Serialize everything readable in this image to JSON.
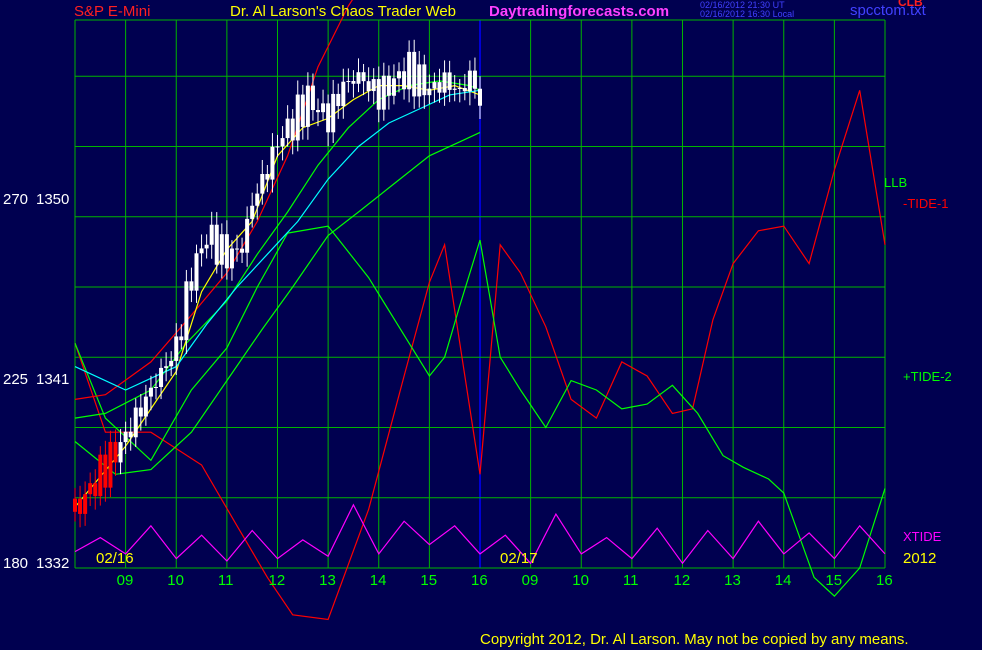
{
  "header": {
    "instrument": "S&P E-Mini",
    "app_title": "Dr. Al Larson's Chaos Trader Web",
    "site": "Daytradingforecasts.com",
    "timestamp_ut": "02/16/2012 21:30 UT",
    "timestamp_local": "02/16/2012 16:30 Local",
    "filename": "spcctom.txt",
    "clb_label": "CLB"
  },
  "footer": {
    "copyright": "Copyright 2012, Dr. Al Larson. May not be copied by any means."
  },
  "right_labels": {
    "llb": "LLB",
    "tide1": "-TIDE-1",
    "tide2": "+TIDE-2",
    "xtide": "XTIDE"
  },
  "colors": {
    "background": "#000050",
    "grid": "#00b400",
    "divider": "#0000ff",
    "price_candles": "#ffffff",
    "price_bear": "#ff0000",
    "tide1": "#ff0000",
    "tide2": "#00ff00",
    "xtide": "#ff00ff",
    "avg_fast": "#ffff00",
    "avg_slow": "#00ffff",
    "band": "#00ff00",
    "band_upper": "#ff0000",
    "title_red": "#ff2020",
    "title_yellow": "#ffff00",
    "site_magenta": "#ff40ff",
    "time_blue": "#4040ff"
  },
  "chart_data": {
    "type": "line",
    "y_labels": [
      {
        "left": "270",
        "price": "1350",
        "value": 1350
      },
      {
        "left": "225",
        "price": "1341",
        "value": 1341
      },
      {
        "left": "180",
        "price": "1332",
        "value": 1332
      }
    ],
    "ylim": [
      1332,
      1355.4
    ],
    "x_ticks": [
      "09",
      "10",
      "11",
      "12",
      "13",
      "14",
      "15",
      "16",
      "09",
      "10",
      "11",
      "12",
      "13",
      "14",
      "15",
      "16"
    ],
    "date_labels": [
      "02/16",
      "02/17",
      "2012"
    ],
    "price_series": {
      "name": "S&P E-Mini",
      "x": [
        8.0,
        8.5,
        9.0,
        9.5,
        10.0,
        10.3,
        10.6,
        11.0,
        11.3,
        11.5,
        11.8,
        12.0,
        12.3,
        12.6,
        13.0,
        13.3,
        13.6,
        14.0,
        14.3,
        14.6,
        15.0,
        15.3,
        15.6,
        15.8,
        16.0
      ],
      "close": [
        1334.4,
        1336.0,
        1337.6,
        1339.6,
        1341.4,
        1344.5,
        1346.2,
        1345.3,
        1345.7,
        1347.6,
        1349.0,
        1350.2,
        1351.0,
        1352.0,
        1351.2,
        1352.6,
        1353.0,
        1352.2,
        1352.8,
        1353.2,
        1352.4,
        1352.8,
        1352.3,
        1353.0,
        1352.0
      ]
    },
    "series": [
      {
        "name": "-TIDE-1",
        "x": [
          8.0,
          8.6,
          9.5,
          10.5,
          11.2,
          11.8,
          12.3,
          13.0,
          13.8,
          14.5,
          15.0,
          15.3,
          15.6,
          16.0,
          16.4,
          16.8,
          17.3,
          17.8,
          18.3,
          18.8,
          19.3,
          19.8,
          20.2,
          20.6,
          21.0,
          21.5,
          22.0,
          22.5,
          23.0,
          23.5,
          24.0
        ],
        "values": [
          1341.6,
          1337.8,
          1337.8,
          1336.4,
          1333.8,
          1331.6,
          1330.0,
          1329.8,
          1334.5,
          1340.2,
          1344.2,
          1345.8,
          1341.6,
          1336.0,
          1345.8,
          1344.6,
          1342.3,
          1339.2,
          1338.4,
          1340.8,
          1340.2,
          1338.6,
          1338.8,
          1342.6,
          1345.0,
          1346.4,
          1346.6,
          1345.0,
          1349.0,
          1352.4,
          1345.8
        ]
      },
      {
        "name": "+TIDE-2",
        "x": [
          8.0,
          8.6,
          9.5,
          10.3,
          11.0,
          11.6,
          12.2,
          13.0,
          13.8,
          14.6,
          15.0,
          15.3,
          15.6,
          16.0,
          16.4,
          16.8,
          17.3,
          17.8,
          18.3,
          18.8,
          19.3,
          19.8,
          20.3,
          20.8,
          21.2,
          21.7,
          22.0,
          22.6,
          23.0,
          23.5,
          24.0
        ],
        "values": [
          1341.6,
          1338.4,
          1336.6,
          1339.6,
          1341.4,
          1344.0,
          1346.3,
          1346.6,
          1344.4,
          1341.6,
          1340.2,
          1341.0,
          1343.2,
          1346.0,
          1341.0,
          1339.6,
          1338.0,
          1340.0,
          1339.6,
          1338.8,
          1339.0,
          1339.8,
          1338.6,
          1336.8,
          1336.3,
          1335.8,
          1335.2,
          1331.6,
          1330.8,
          1332.0,
          1335.4
        ]
      },
      {
        "name": "XTIDE",
        "x": [
          8.0,
          8.5,
          9.0,
          9.5,
          10.0,
          10.5,
          11.0,
          11.5,
          12.0,
          12.5,
          13.0,
          13.5,
          14.0,
          14.5,
          15.0,
          15.5,
          16.0,
          16.5,
          17.0,
          17.5,
          18.0,
          18.5,
          19.0,
          19.5,
          20.0,
          20.5,
          21.0,
          21.5,
          22.0,
          22.5,
          23.0,
          23.5,
          24.0
        ],
        "values": [
          1332.7,
          1333.3,
          1332.6,
          1333.8,
          1332.4,
          1333.4,
          1332.3,
          1333.6,
          1332.4,
          1333.2,
          1332.5,
          1334.7,
          1332.6,
          1334.0,
          1333.0,
          1333.8,
          1332.6,
          1333.4,
          1332.2,
          1334.3,
          1332.6,
          1333.3,
          1332.4,
          1333.7,
          1332.2,
          1333.6,
          1332.4,
          1334.0,
          1332.6,
          1333.5,
          1332.4,
          1333.8,
          1332.6
        ]
      },
      {
        "name": "LLB",
        "x": [
          8.0,
          8.8,
          9.5,
          10.3,
          11.0,
          11.7,
          12.3,
          13.0,
          13.6,
          14.3,
          15.0,
          15.6,
          16.0
        ],
        "values": [
          1337.4,
          1336.0,
          1336.2,
          1337.8,
          1340.0,
          1342.2,
          1344.0,
          1346.2,
          1347.2,
          1348.4,
          1349.6,
          1350.2,
          1350.6
        ]
      },
      {
        "name": "Upper band",
        "x": [
          8.0,
          8.6,
          9.5,
          10.3,
          11.0,
          11.6,
          12.2,
          12.8,
          13.4,
          14.0,
          14.6,
          15.0
        ],
        "values": [
          1339.2,
          1339.4,
          1340.8,
          1342.8,
          1344.6,
          1346.8,
          1349.6,
          1353.4,
          1356.0,
          1358.0,
          1359.6,
          1360.4
        ]
      },
      {
        "name": "Middle band",
        "x": [
          8.0,
          8.6,
          9.5,
          10.2,
          11.0,
          11.6,
          12.2,
          12.8,
          13.4,
          14.0,
          14.6,
          15.2,
          15.8,
          16.0
        ],
        "values": [
          1338.4,
          1338.6,
          1339.6,
          1341.6,
          1343.4,
          1345.4,
          1347.2,
          1349.2,
          1350.8,
          1352.0,
          1352.6,
          1352.8,
          1352.6,
          1352.4
        ]
      },
      {
        "name": "Fast average",
        "x": [
          8.0,
          9.0,
          10.0,
          10.5,
          11.0,
          11.5,
          12.0,
          12.5,
          13.0,
          13.5,
          14.0,
          14.5,
          15.0,
          15.5,
          16.0
        ],
        "values": [
          1334.6,
          1337.2,
          1340.4,
          1343.8,
          1345.6,
          1346.8,
          1349.6,
          1350.8,
          1351.2,
          1352.0,
          1352.6,
          1352.6,
          1352.4,
          1352.6,
          1352.2
        ]
      },
      {
        "name": "Slow average",
        "x": [
          8.0,
          9.0,
          10.0,
          10.6,
          11.2,
          11.8,
          12.4,
          13.0,
          13.6,
          14.2,
          14.8,
          15.4,
          16.0
        ],
        "values": [
          1340.6,
          1339.6,
          1340.6,
          1342.4,
          1344.0,
          1345.4,
          1346.8,
          1348.6,
          1350.0,
          1351.0,
          1351.6,
          1352.2,
          1352.4
        ]
      }
    ]
  }
}
